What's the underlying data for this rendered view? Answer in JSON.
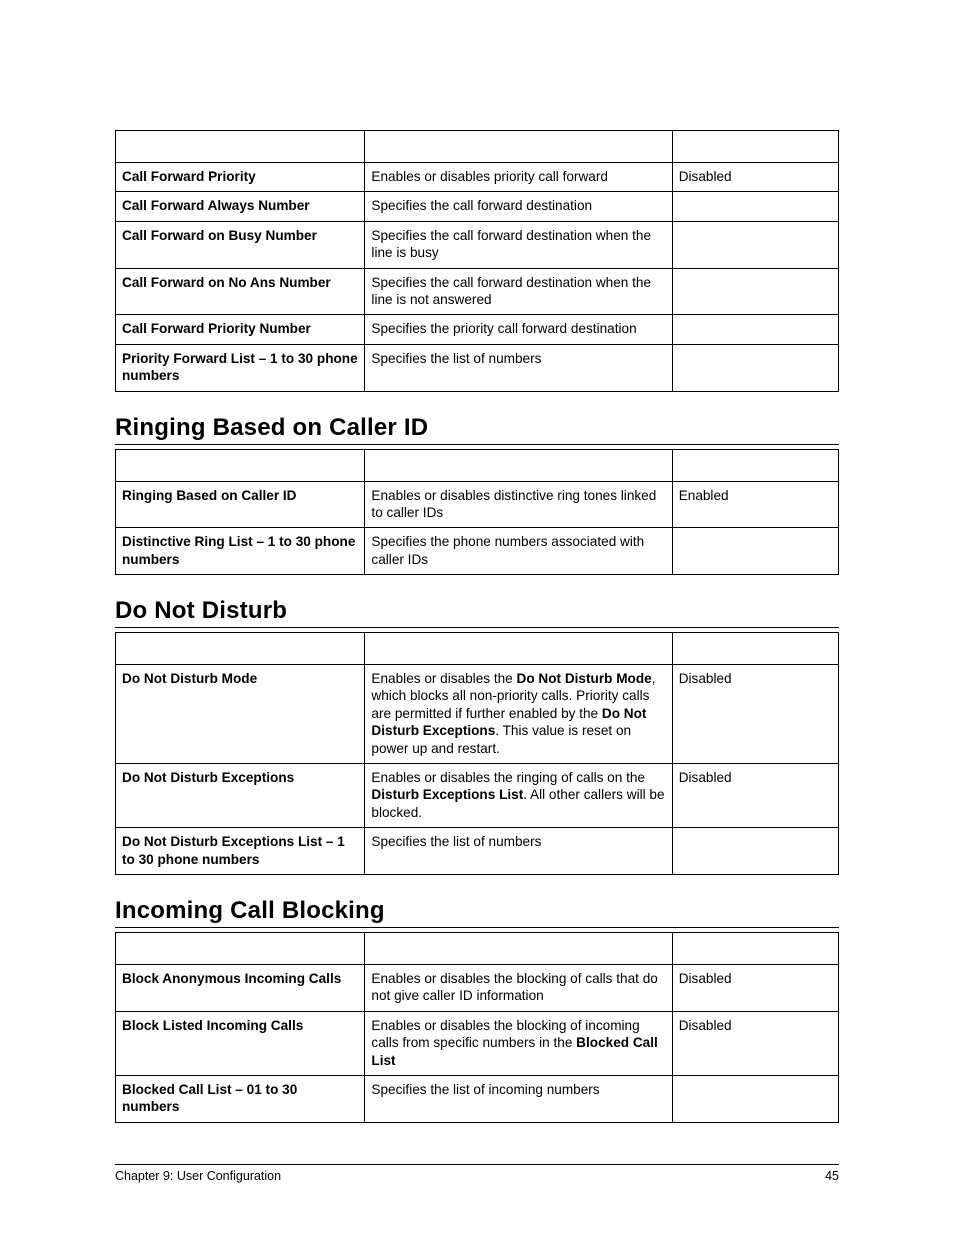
{
  "call_forward_table": {
    "rows": [
      {
        "field": "Call Forward Priority",
        "desc": "Enables or disables priority call forward",
        "default": "Disabled"
      },
      {
        "field": "Call Forward Always Number",
        "desc": "Specifies the call forward destination",
        "default": ""
      },
      {
        "field": "Call Forward on Busy Number",
        "desc": "Specifies the call forward destination when the line is busy",
        "default": ""
      },
      {
        "field": "Call Forward on No Ans Number",
        "desc": "Specifies the call forward destination when the line is not answered",
        "default": ""
      },
      {
        "field": "Call Forward Priority Number",
        "desc": "Specifies the priority call forward destination",
        "default": ""
      },
      {
        "field": "Priority Forward List – 1 to 30 phone numbers",
        "desc": "Specifies the list of numbers",
        "default": ""
      }
    ]
  },
  "ringing": {
    "title": "Ringing Based on Caller ID",
    "rows": [
      {
        "field": "Ringing Based on Caller ID",
        "desc": "Enables or disables distinctive ring tones linked to caller IDs",
        "default": "Enabled"
      },
      {
        "field": "Distinctive Ring List – 1 to 30 phone numbers",
        "desc": "Specifies the phone numbers associated with caller IDs",
        "default": ""
      }
    ]
  },
  "dnd": {
    "title": "Do Not Disturb",
    "rows": [
      {
        "field": "Do Not Disturb Mode",
        "desc_parts": [
          "Enables or disables the ",
          "Do Not Disturb Mode",
          ", which blocks all non-priority calls. Priority calls are permitted if further enabled by the ",
          "Do Not Disturb Exceptions",
          ". This value is reset on power up and restart."
        ],
        "default": "Disabled"
      },
      {
        "field": "Do Not Disturb Exceptions",
        "desc_parts": [
          "Enables or disables the ringing of calls on the ",
          "Disturb Exceptions List",
          ". All other callers will be blocked."
        ],
        "default": "Disabled"
      },
      {
        "field": "Do Not Disturb Exceptions List – 1 to 30 phone numbers",
        "desc": "Specifies the list of numbers",
        "default": ""
      }
    ]
  },
  "icb": {
    "title": "Incoming Call Blocking",
    "rows": [
      {
        "field": "Block Anonymous Incoming Calls",
        "desc": "Enables or disables the blocking of calls that do not give caller ID information",
        "default": "Disabled"
      },
      {
        "field": "Block Listed Incoming Calls",
        "desc_parts": [
          "Enables or disables the blocking of incoming calls from specific numbers in the ",
          "Blocked Call List"
        ],
        "default": "Disabled"
      },
      {
        "field": "Blocked Call List – 01 to 30 numbers",
        "desc": "Specifies the list of incoming numbers",
        "default": ""
      }
    ]
  },
  "footer": {
    "left": "Chapter 9:  User Configuration",
    "right": "45"
  }
}
